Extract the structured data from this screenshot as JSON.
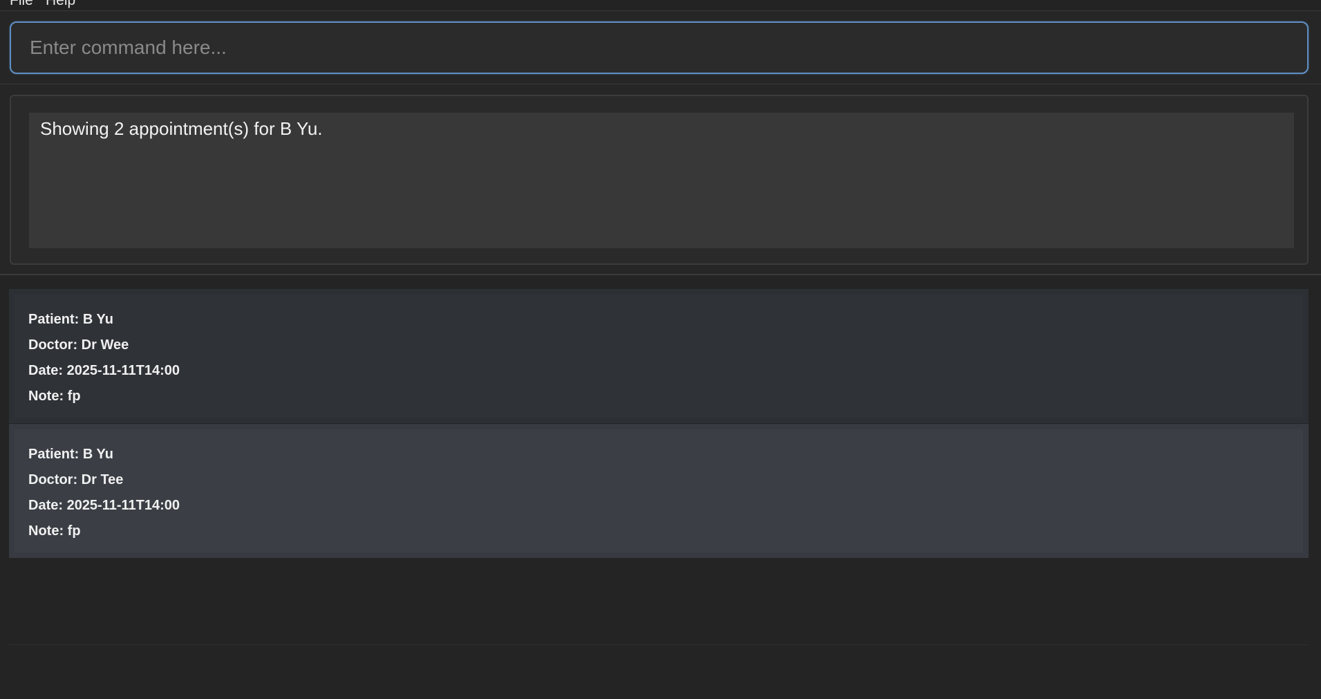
{
  "menu": {
    "items": [
      {
        "label": "File"
      },
      {
        "label": "Help"
      }
    ]
  },
  "command": {
    "placeholder": "Enter command here...",
    "value": ""
  },
  "result": {
    "message": "Showing 2 appointment(s) for B Yu."
  },
  "appointments": [
    {
      "patient": "Patient: B Yu",
      "doctor": "Doctor: Dr Wee",
      "date": "Date: 2025-11-11T14:00",
      "note": "Note: fp"
    },
    {
      "patient": "Patient: B Yu",
      "doctor": "Doctor: Dr Tee",
      "date": "Date: 2025-11-11T14:00",
      "note": "Note: fp"
    }
  ],
  "colors": {
    "accent": "#5f8fc4",
    "background": "#262626",
    "card_odd": "#2f3237",
    "card_even": "#3b3f45"
  }
}
